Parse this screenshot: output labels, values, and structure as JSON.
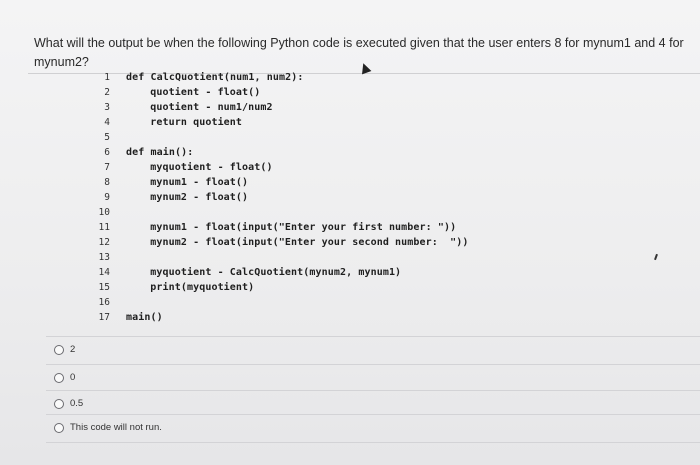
{
  "question": {
    "line1": "What will the output be when the following Python code is executed given that the user enters 8 for mynum1 and 4 for",
    "line2": "mynum2?"
  },
  "code": [
    {
      "n": "1",
      "text": "def CalcQuotient(num1, num2):"
    },
    {
      "n": "2",
      "text": "  quotient - float()"
    },
    {
      "n": "3",
      "text": "  quotient - num1/num2"
    },
    {
      "n": "4",
      "text": "  return quotient"
    },
    {
      "n": "5",
      "text": ""
    },
    {
      "n": "6",
      "text": "def main():"
    },
    {
      "n": "7",
      "text": "  myquotient - float()"
    },
    {
      "n": "8",
      "text": "  mynum1 - float()"
    },
    {
      "n": "9",
      "text": "  mynum2 - float()"
    },
    {
      "n": "10",
      "text": ""
    },
    {
      "n": "11",
      "text": "  mynum1 - float(input(\"Enter your first number: \"))"
    },
    {
      "n": "12",
      "text": "  mynum2 - float(input(\"Enter your second number:  \"))"
    },
    {
      "n": "13",
      "text": ""
    },
    {
      "n": "14",
      "text": "  myquotient - CalcQuotient(mynum2, mynum1)"
    },
    {
      "n": "15",
      "text": "  print(myquotient)"
    },
    {
      "n": "16",
      "text": ""
    },
    {
      "n": "17",
      "text": "main()"
    }
  ],
  "options": [
    {
      "label": "2"
    },
    {
      "label": "0"
    },
    {
      "label": "0.5"
    },
    {
      "label": "This code will not run."
    }
  ]
}
